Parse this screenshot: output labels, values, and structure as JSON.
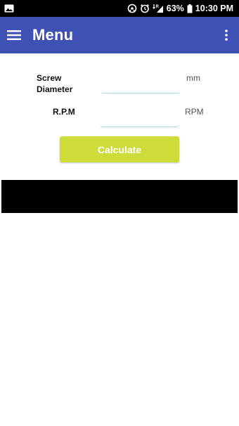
{
  "status_bar": {
    "battery": "63%",
    "time": "10:30 PM",
    "network_superscript": "R"
  },
  "app_bar": {
    "title": "Menu"
  },
  "form": {
    "screw_diameter_label_line1": "Screw",
    "screw_diameter_label_line2": "Diameter",
    "screw_diameter_value": "",
    "screw_diameter_unit": "mm",
    "rpm_label": "R.P.M",
    "rpm_value": "",
    "rpm_unit": "RPM",
    "calculate_label": "Calculate"
  },
  "colors": {
    "app_bar": "#3f51b5",
    "button": "#cddc39",
    "field_underline": "#a9dcd7"
  },
  "icons": [
    "image-notification-icon",
    "cast-icon",
    "alarm-icon",
    "signal-icon",
    "battery-icon",
    "hamburger-menu-icon",
    "overflow-menu-icon"
  ]
}
